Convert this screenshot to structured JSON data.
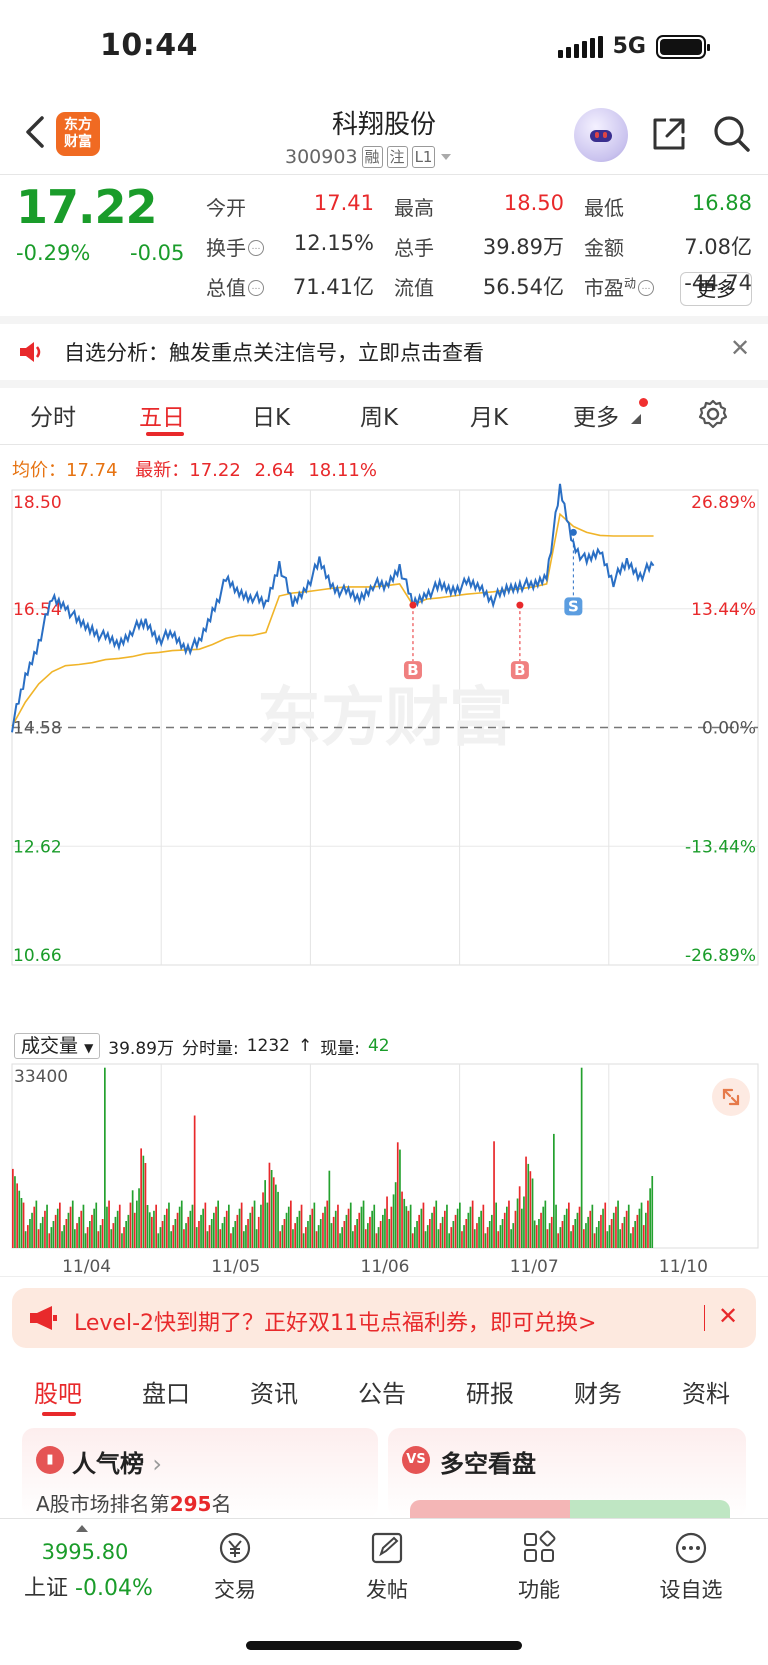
{
  "status": {
    "time": "10:44",
    "network": "5G"
  },
  "header": {
    "stock_name": "科翔股份",
    "stock_code": "300903",
    "tags": [
      "融",
      "注",
      "L1"
    ],
    "logo_text_top": "东方",
    "logo_text_bottom": "财富"
  },
  "quote": {
    "price": "17.22",
    "change_pct": "-0.29%",
    "change": "-0.05",
    "fields": [
      {
        "label": "今开",
        "value": "17.41",
        "color": "red"
      },
      {
        "label": "最高",
        "value": "18.50",
        "color": "red"
      },
      {
        "label": "最低",
        "value": "16.88",
        "color": "green"
      },
      {
        "label": "换手",
        "value": "12.15%",
        "color": "gray"
      },
      {
        "label": "总手",
        "value": "39.89万",
        "color": "gray"
      },
      {
        "label": "金额",
        "value": "7.08亿",
        "color": "gray"
      },
      {
        "label": "总值",
        "value": "71.41亿",
        "color": "gray"
      },
      {
        "label": "流值",
        "value": "56.54亿",
        "color": "gray"
      },
      {
        "label": "市盈",
        "sup": "动",
        "value": "-44.74",
        "color": "gray"
      }
    ],
    "more_label": "更多"
  },
  "notice": {
    "text": "自选分析：触发重点关注信号，立即点击查看"
  },
  "chart_tabs": [
    "分时",
    "五日",
    "日K",
    "周K",
    "月K",
    "更多"
  ],
  "avg_line": {
    "avg_label": "均价：",
    "avg_value": "17.74",
    "latest_label": "最新：",
    "latest_value": "17.22",
    "diff": "2.64",
    "diff_pct": "18.11%"
  },
  "chart_data": {
    "type": "line",
    "title": "",
    "y_ticks_left": [
      "18.50",
      "16.54",
      "14.58",
      "12.62",
      "10.66"
    ],
    "y_ticks_right": [
      "26.89%",
      "13.44%",
      "0.00%",
      "-13.44%",
      "-26.89%"
    ],
    "ylim": [
      10.66,
      18.5
    ],
    "reference_price": 14.58,
    "x_categories": [
      "11/04",
      "11/05",
      "11/06",
      "11/07",
      "11/10"
    ],
    "series": [
      {
        "name": "price",
        "values": [
          14.6,
          15.4,
          16.0,
          16.7,
          16.6,
          16.3,
          16.2,
          16.05,
          15.95,
          16.2,
          16.3,
          16.05,
          16.1,
          15.9,
          15.95,
          16.5,
          17.0,
          16.8,
          16.75,
          16.6,
          17.3,
          16.6,
          16.9,
          17.3,
          16.9,
          16.8,
          16.7,
          16.95,
          16.9,
          17.25,
          16.6,
          16.8,
          16.9,
          16.85,
          16.95,
          16.9,
          16.7,
          16.85,
          16.95,
          16.9,
          17.1,
          18.5,
          17.6,
          17.3,
          17.5,
          17.0,
          17.3,
          17.1,
          17.25
        ]
      },
      {
        "name": "avg",
        "values": [
          14.6,
          15.0,
          15.3,
          15.5,
          15.6,
          15.62,
          15.65,
          15.7,
          15.72,
          15.75,
          15.8,
          15.82,
          15.85,
          15.86,
          15.87,
          15.95,
          16.05,
          16.1,
          16.1,
          16.15,
          16.75,
          16.8,
          16.82,
          16.85,
          16.88,
          16.9,
          16.9,
          16.9,
          16.92,
          16.95,
          16.6,
          16.7,
          16.72,
          16.75,
          16.78,
          16.8,
          16.82,
          16.85,
          16.87,
          16.9,
          16.95,
          18.1,
          17.9,
          17.8,
          17.75,
          17.74,
          17.74,
          17.74,
          17.74
        ]
      }
    ],
    "trade_markers": [
      {
        "label": "B",
        "x_index": 30,
        "price": 16.6
      },
      {
        "label": "B",
        "x_index": 38,
        "price": 16.6
      },
      {
        "label": "S",
        "x_index": 42,
        "price": 17.8
      }
    ],
    "watermark": "东方财富"
  },
  "volume": {
    "selector": "成交量",
    "total": "39.89万",
    "fenshi_label": "分时量:",
    "fenshi_value": "1232",
    "arrow": "↑",
    "now_label": "现量:",
    "now_value": "42",
    "max_tick": "33400"
  },
  "banner": {
    "text": "Level-2快到期了？正好双11屯点福利券，即可兑换>"
  },
  "section_tabs": [
    "股吧",
    "盘口",
    "资讯",
    "公告",
    "研报",
    "财务",
    "资料"
  ],
  "cards": {
    "popularity_title": "人气榜",
    "popularity_sub_prefix": "A股市场排名第",
    "popularity_rank": "295",
    "popularity_sub_suffix": "名",
    "bull_bear_title": "多空看盘",
    "vs_icon": "VS"
  },
  "bottom_nav": {
    "index_value": "3995.80",
    "index_name": "上证",
    "index_change": "-0.04%",
    "items": [
      "交易",
      "发帖",
      "功能",
      "设自选"
    ]
  }
}
